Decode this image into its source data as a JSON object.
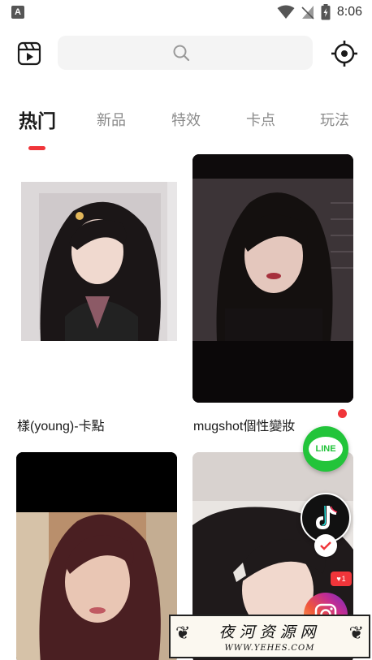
{
  "status_bar": {
    "app_indicator": "A",
    "time": "8:06",
    "icons": [
      "wifi-icon",
      "no-signal-icon",
      "battery-charging-icon"
    ]
  },
  "topbar": {
    "template_icon": "video-template-icon",
    "search_icon": "search-icon",
    "settings_icon": "settings-icon"
  },
  "tabs": [
    {
      "label": "热门",
      "active": true
    },
    {
      "label": "新品",
      "active": false
    },
    {
      "label": "特效",
      "active": false
    },
    {
      "label": "卡点",
      "active": false
    },
    {
      "label": "玩法",
      "active": false
    }
  ],
  "cards": [
    {
      "title": "樣(young)-卡點",
      "image": "girl-portrait-photo"
    },
    {
      "title": "mugshot個性變妝",
      "image": "mugshot-portrait-photo",
      "new_dot": true
    },
    {
      "title": "",
      "image": "wink-selfie-photo"
    },
    {
      "title": "",
      "image": "hairclip-portrait-photo"
    }
  ],
  "floating": {
    "line_label": "LINE",
    "like_count": "1"
  },
  "watermark": {
    "title": "夜河资源网",
    "url": "WWW.YEHES.COM"
  },
  "colors": {
    "accent": "#f0353a",
    "line_green": "#22c43a",
    "tab_inactive": "#8a8a8a"
  }
}
